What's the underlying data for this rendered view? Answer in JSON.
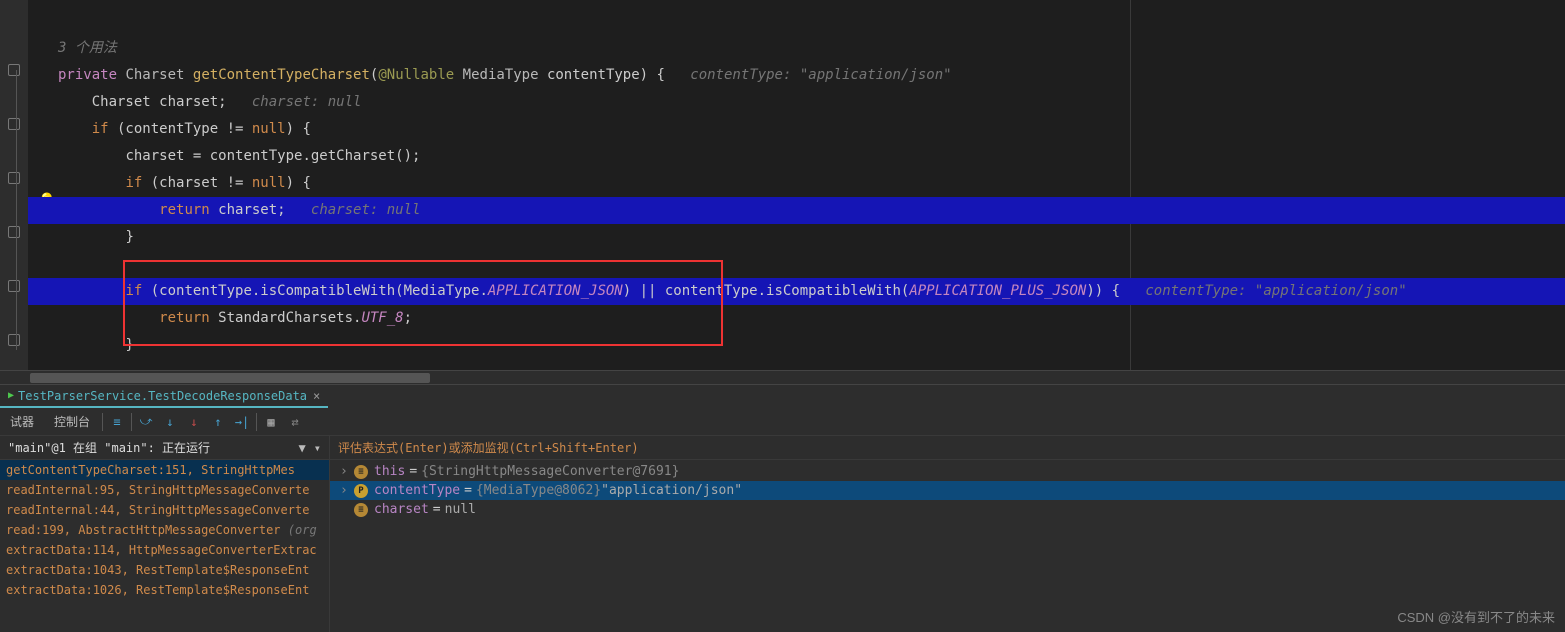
{
  "code": {
    "usage_hint": "3 个用法",
    "l1_private": "private",
    "l1_type": "Charset",
    "l1_method": "getContentTypeCharset",
    "l1_anno": "@Nullable",
    "l1_param_type": "MediaType",
    "l1_param": "contentType) {",
    "l1_inline": "contentType: \"application/json\"",
    "l2_decl": "Charset charset;",
    "l2_inline": "charset: null",
    "l3_if": "if",
    "l3_cond": " (contentType != ",
    "l3_null": "null",
    "l3_close": ") {",
    "l4": "charset = contentType.getCharset();",
    "l5_if": "if",
    "l5_cond": " (charset != ",
    "l5_null": "null",
    "l5_close": ") {",
    "l6_return": "return",
    "l6_var": " charset;",
    "l6_inline": "charset: null",
    "l7": "}",
    "l9_if": "if",
    "l9_a": " (contentType.isCompatibleWith(MediaType.",
    "l9_field1": "APPLICATION_JSON",
    "l9_b": ") || contentType.isCompatibleWith(",
    "l9_field2": "APPLICATION_PLUS_JSON",
    "l9_c": ")) {",
    "l9_inline": "contentType: \"application/json\"",
    "l10_return": "return",
    "l10_a": " StandardCharsets.",
    "l10_field": "UTF_8",
    "l10_b": ";",
    "l11": "}"
  },
  "run_tab": {
    "label": "TestParserService.TestDecodeResponseData",
    "close": "×"
  },
  "toolbar": {
    "tab1": "试器",
    "tab2": "控制台"
  },
  "frames": {
    "header": "\"main\"@1 在组 \"main\": 正在运行",
    "items": [
      "getContentTypeCharset:151, StringHttpMes",
      "readInternal:95, StringHttpMessageConverte",
      "readInternal:44, StringHttpMessageConverte",
      "read:199, AbstractHttpMessageConverter",
      "extractData:114, HttpMessageConverterExtrac",
      "extractData:1043, RestTemplate$ResponseEnt",
      "extractData:1026, RestTemplate$ResponseEnt"
    ],
    "tails": [
      "",
      "",
      "",
      " (org",
      "",
      "",
      ""
    ]
  },
  "vars": {
    "eval_placeholder": "评估表达式(Enter)或添加监视(Ctrl+Shift+Enter)",
    "this_name": "this",
    "this_val": "{StringHttpMessageConverter@7691}",
    "ct_name": "contentType",
    "ct_obj": "{MediaType@8062}",
    "ct_str": " \"application/json\"",
    "charset_name": "charset",
    "charset_val": "null"
  },
  "watermark": "CSDN @没有到不了的未来"
}
